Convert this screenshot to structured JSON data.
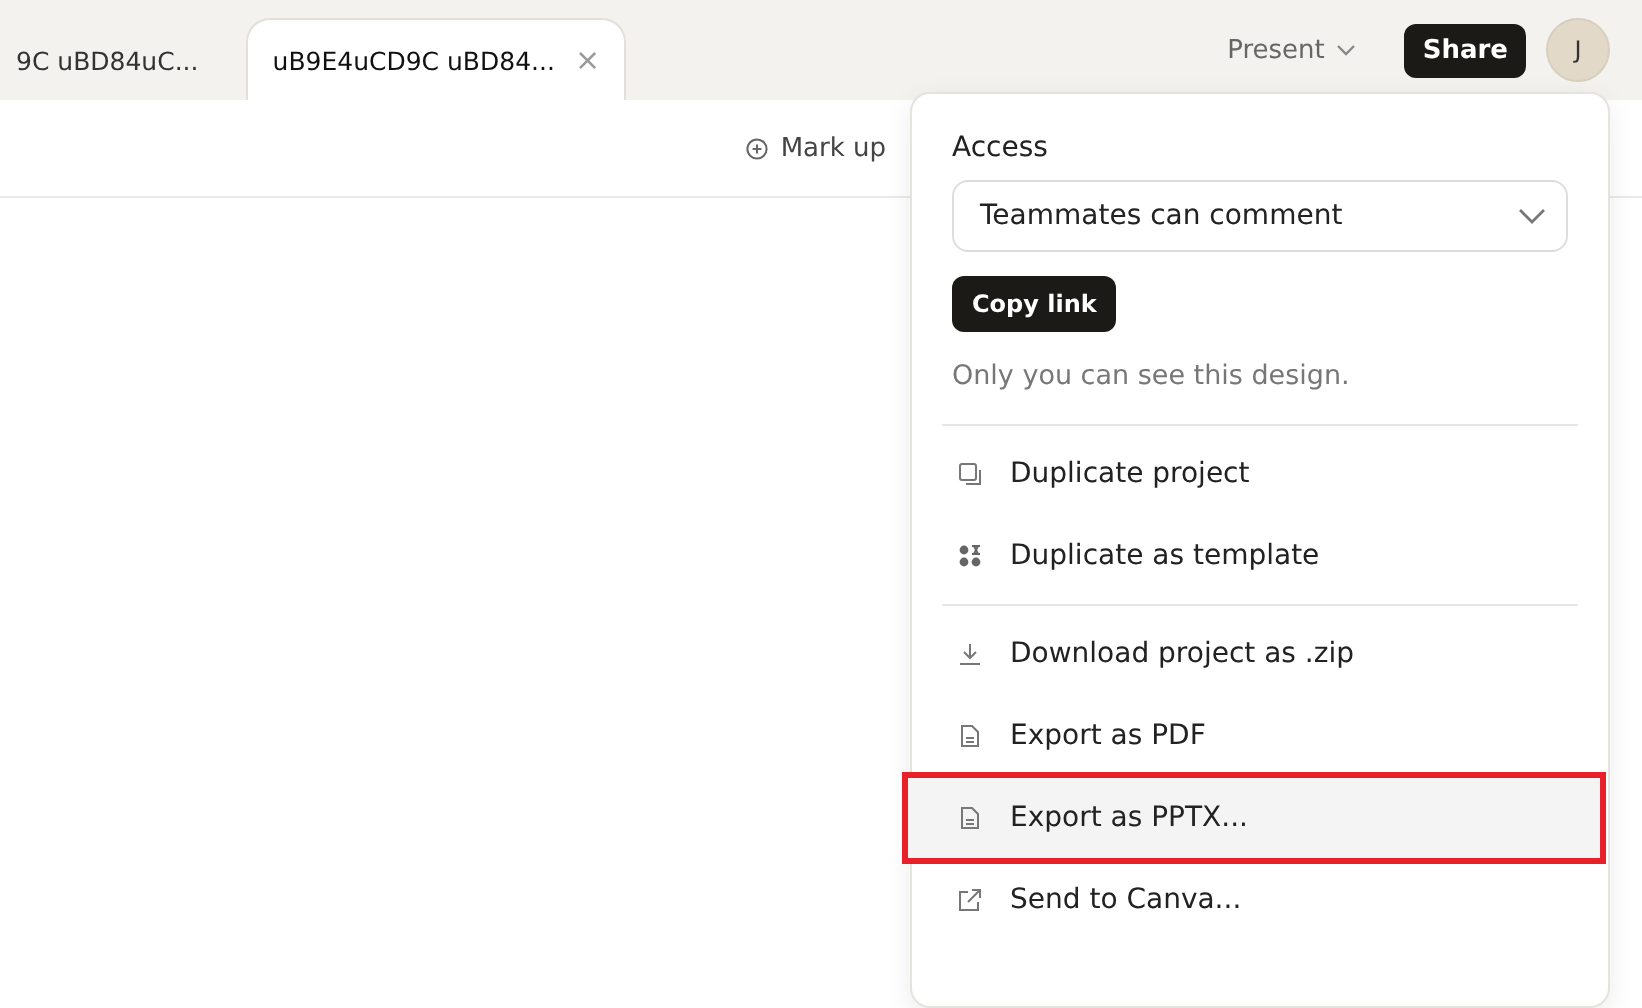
{
  "tabs": [
    {
      "label": "9C uBD84uC...",
      "selected": false
    },
    {
      "label": "uB9E4uCD9C uBD84...",
      "selected": true,
      "close": "×"
    }
  ],
  "header": {
    "present": "Present",
    "share": "Share",
    "avatar": "J"
  },
  "toolbar": {
    "markup": "Mark up"
  },
  "share_menu": {
    "access_label": "Access",
    "access_value": "Teammates can comment",
    "copy_link": "Copy link",
    "note": "Only you can see this design.",
    "groups": [
      [
        {
          "label": "Duplicate project",
          "highlighted": false
        },
        {
          "label": "Duplicate as template",
          "highlighted": false
        }
      ],
      [
        {
          "label": "Download project as .zip",
          "highlighted": false
        },
        {
          "label": "Export as PDF",
          "highlighted": false
        },
        {
          "label": "Export as PPTX...",
          "highlighted": true
        },
        {
          "label": "Send to Canva...",
          "highlighted": false
        }
      ]
    ]
  }
}
